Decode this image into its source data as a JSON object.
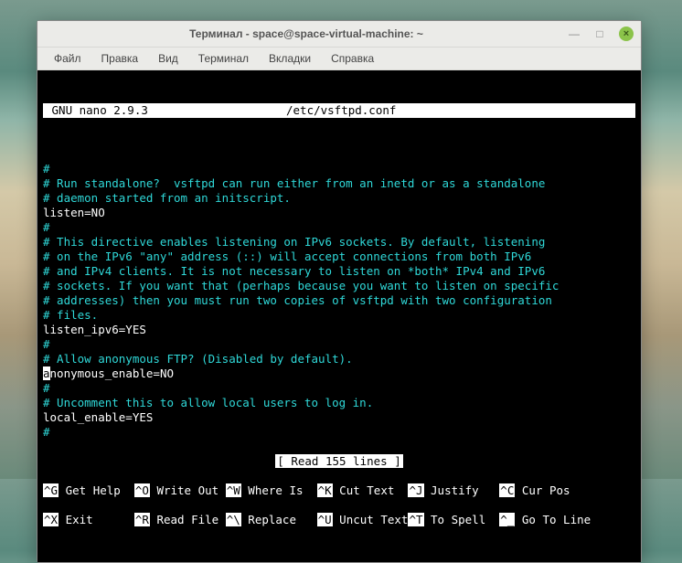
{
  "titlebar": {
    "title": "Терминал - space@space-virtual-machine: ~",
    "minimize": "—",
    "maximize": "□",
    "close": "×"
  },
  "menubar": {
    "items": [
      "Файл",
      "Правка",
      "Вид",
      "Терминал",
      "Вкладки",
      "Справка"
    ]
  },
  "editor": {
    "header_left": " GNU nano 2.9.3 ",
    "header_file": "/etc/vsftpd.conf",
    "lines": [
      {
        "t": "comment",
        "txt": "#"
      },
      {
        "t": "comment",
        "txt": "# Run standalone?  vsftpd can run either from an inetd or as a standalone"
      },
      {
        "t": "comment",
        "txt": "# daemon started from an initscript."
      },
      {
        "t": "config",
        "txt": "listen=NO"
      },
      {
        "t": "comment",
        "txt": "#"
      },
      {
        "t": "comment",
        "txt": "# This directive enables listening on IPv6 sockets. By default, listening"
      },
      {
        "t": "comment",
        "txt": "# on the IPv6 \"any\" address (::) will accept connections from both IPv6"
      },
      {
        "t": "comment",
        "txt": "# and IPv4 clients. It is not necessary to listen on *both* IPv4 and IPv6"
      },
      {
        "t": "comment",
        "txt": "# sockets. If you want that (perhaps because you want to listen on specific"
      },
      {
        "t": "comment",
        "txt": "# addresses) then you must run two copies of vsftpd with two configuration"
      },
      {
        "t": "comment",
        "txt": "# files."
      },
      {
        "t": "config",
        "txt": "listen_ipv6=YES"
      },
      {
        "t": "comment",
        "txt": "#"
      },
      {
        "t": "comment",
        "txt": "# Allow anonymous FTP? (Disabled by default)."
      },
      {
        "t": "config",
        "cursor": "a",
        "txt": "nonymous_enable=NO"
      },
      {
        "t": "comment",
        "txt": "#"
      },
      {
        "t": "comment",
        "txt": "# Uncomment this to allow local users to log in."
      },
      {
        "t": "config",
        "txt": "local_enable=YES"
      },
      {
        "t": "comment",
        "txt": "#"
      }
    ],
    "status": "[ Read 155 lines ]",
    "shortcuts_row1": [
      {
        "key": "^G",
        "label": " Get Help  "
      },
      {
        "key": "^O",
        "label": " Write Out "
      },
      {
        "key": "^W",
        "label": " Where Is  "
      },
      {
        "key": "^K",
        "label": " Cut Text  "
      },
      {
        "key": "^J",
        "label": " Justify   "
      },
      {
        "key": "^C",
        "label": " Cur Pos"
      }
    ],
    "shortcuts_row2": [
      {
        "key": "^X",
        "label": " Exit      "
      },
      {
        "key": "^R",
        "label": " Read File "
      },
      {
        "key": "^\\",
        "label": " Replace   "
      },
      {
        "key": "^U",
        "label": " Uncut Text"
      },
      {
        "key": "^T",
        "label": " To Spell  "
      },
      {
        "key": "^_",
        "label": " Go To Line"
      }
    ]
  }
}
